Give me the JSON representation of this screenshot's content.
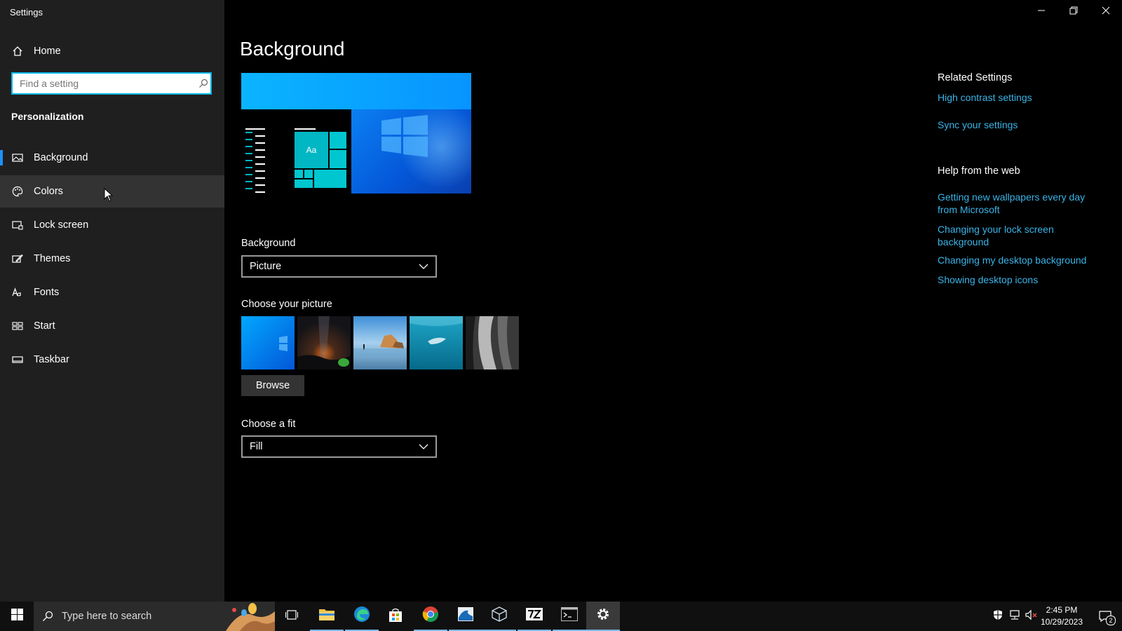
{
  "window": {
    "title": "Settings",
    "controls": {
      "minimize": "minimize-icon",
      "restore": "restore-icon",
      "close": "close-icon"
    }
  },
  "sidebar": {
    "home_label": "Home",
    "search_placeholder": "Find a setting",
    "section_title": "Personalization",
    "items": [
      {
        "label": "Background",
        "icon": "picture-icon",
        "selected": true
      },
      {
        "label": "Colors",
        "icon": "palette-icon"
      },
      {
        "label": "Lock screen",
        "icon": "lock-screen-icon"
      },
      {
        "label": "Themes",
        "icon": "themes-icon"
      },
      {
        "label": "Fonts",
        "icon": "fonts-icon"
      },
      {
        "label": "Start",
        "icon": "start-icon"
      },
      {
        "label": "Taskbar",
        "icon": "taskbar-icon"
      }
    ]
  },
  "main": {
    "title": "Background",
    "preview_tile_text": "Aa",
    "background_label": "Background",
    "background_value": "Picture",
    "choose_picture_label": "Choose your picture",
    "browse_label": "Browse",
    "fit_label": "Choose a fit",
    "fit_value": "Fill"
  },
  "related": {
    "heading": "Related Settings",
    "links": [
      "High contrast settings",
      "Sync your settings"
    ]
  },
  "help": {
    "heading": "Help from the web",
    "links": [
      "Getting new wallpapers every day from Microsoft",
      "Changing your lock screen background",
      "Changing my desktop background",
      "Showing desktop icons"
    ]
  },
  "taskbar": {
    "search_placeholder": "Type here to search",
    "time": "2:45 PM",
    "date": "10/29/2023",
    "notification_count": "2",
    "accent": "#00b4e6"
  }
}
